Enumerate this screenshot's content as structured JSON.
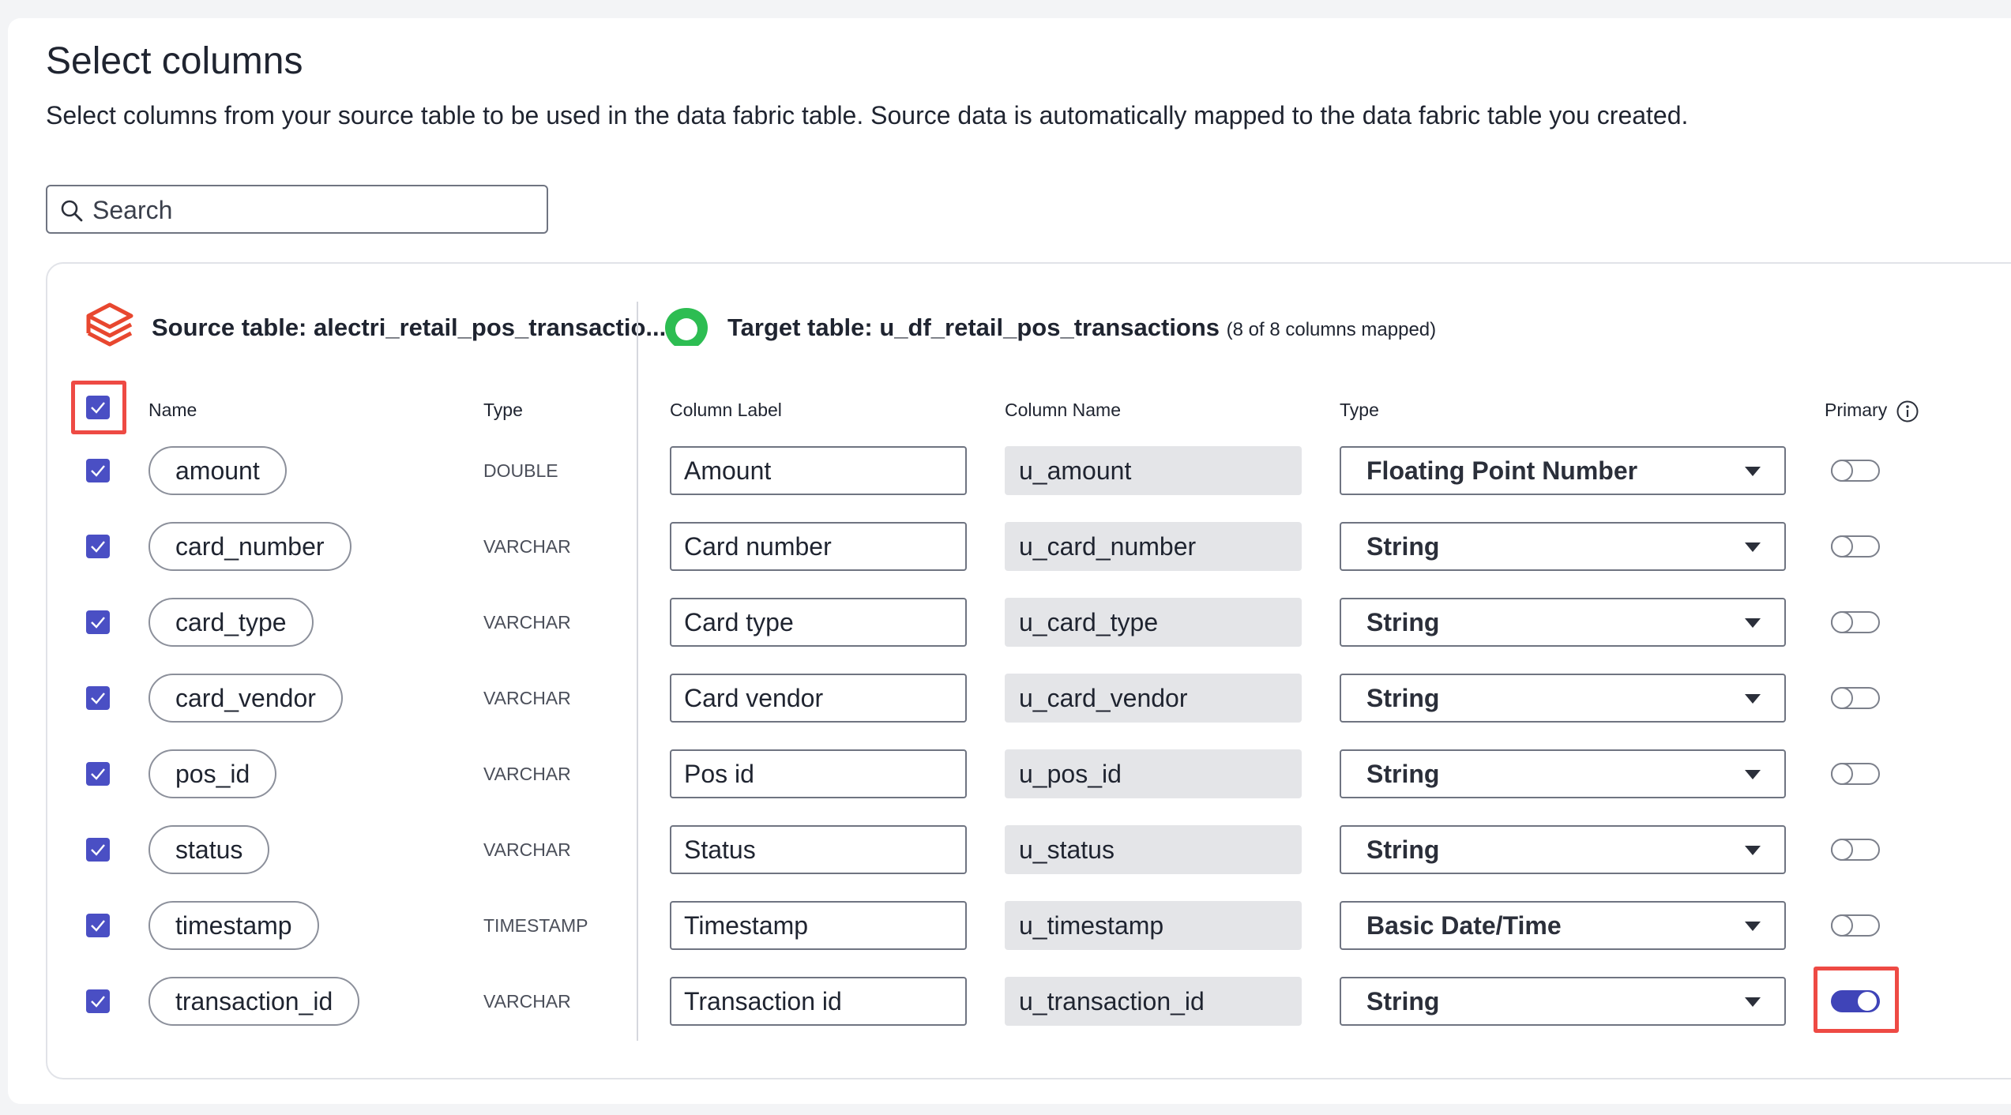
{
  "page": {
    "title": "Select columns",
    "subtitle": "Select columns from your source table to be used in the data fabric table. Source data is automatically mapped to the data fabric table you created."
  },
  "search": {
    "placeholder": "Search",
    "icon": "search-icon"
  },
  "source": {
    "label": "Source table: alectri_retail_pos_transactio...",
    "icon": "databricks-layers-icon",
    "icon_color": "#e8472f"
  },
  "target": {
    "label": "Target table: u_df_retail_pos_transactions",
    "meta": "(8 of 8 columns mapped)",
    "icon": "target-ring-icon",
    "icon_color": "#2dbd52"
  },
  "columns_header": {
    "name": "Name",
    "type": "Type",
    "column_label": "Column Label",
    "column_name": "Column Name",
    "target_type": "Type",
    "primary": "Primary"
  },
  "select_all_checked": true,
  "accent": "#4a4fc4",
  "highlight": "#ee4a44",
  "rows": [
    {
      "checked": true,
      "name": "amount",
      "src_type": "DOUBLE",
      "label": "Amount",
      "col_name": "u_amount",
      "type": "Floating Point Number",
      "primary": false
    },
    {
      "checked": true,
      "name": "card_number",
      "src_type": "VARCHAR",
      "label": "Card number",
      "col_name": "u_card_number",
      "type": "String",
      "primary": false
    },
    {
      "checked": true,
      "name": "card_type",
      "src_type": "VARCHAR",
      "label": "Card type",
      "col_name": "u_card_type",
      "type": "String",
      "primary": false
    },
    {
      "checked": true,
      "name": "card_vendor",
      "src_type": "VARCHAR",
      "label": "Card vendor",
      "col_name": "u_card_vendor",
      "type": "String",
      "primary": false
    },
    {
      "checked": true,
      "name": "pos_id",
      "src_type": "VARCHAR",
      "label": "Pos id",
      "col_name": "u_pos_id",
      "type": "String",
      "primary": false
    },
    {
      "checked": true,
      "name": "status",
      "src_type": "VARCHAR",
      "label": "Status",
      "col_name": "u_status",
      "type": "String",
      "primary": false
    },
    {
      "checked": true,
      "name": "timestamp",
      "src_type": "TIMESTAMP",
      "label": "Timestamp",
      "col_name": "u_timestamp",
      "type": "Basic Date/Time",
      "primary": false
    },
    {
      "checked": true,
      "name": "transaction_id",
      "src_type": "VARCHAR",
      "label": "Transaction id",
      "col_name": "u_transaction_id",
      "type": "String",
      "primary": true
    }
  ]
}
